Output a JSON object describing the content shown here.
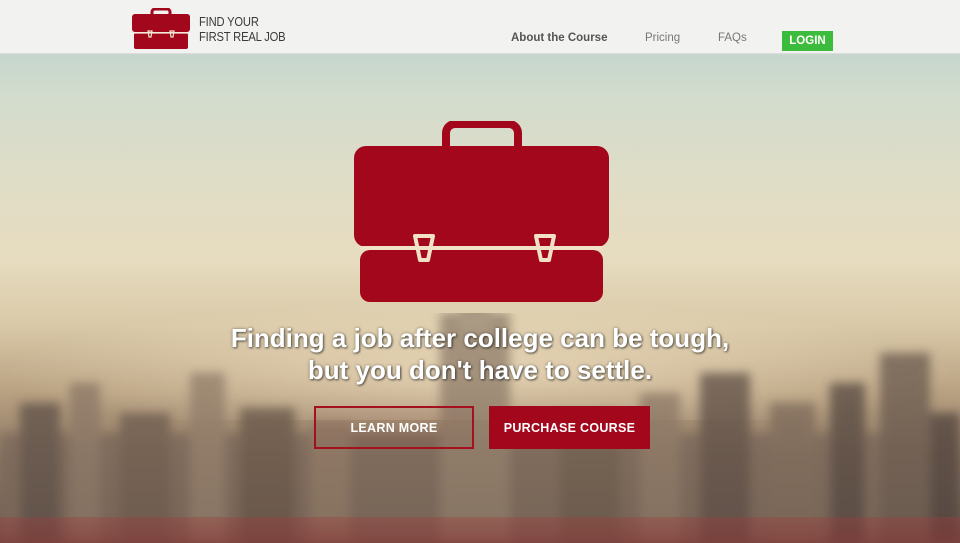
{
  "header": {
    "logo_line1": "FIND YOUR",
    "logo_line2": "FIRST REAL JOB",
    "nav": [
      {
        "label": "About the Course",
        "active": true
      },
      {
        "label": "Pricing",
        "active": false
      },
      {
        "label": "FAQs",
        "active": false
      }
    ],
    "login_label": "LOGIN"
  },
  "hero": {
    "headline_line1": "Finding a job after college can be tough,",
    "headline_line2": "but you don't have to settle.",
    "learn_more_label": "LEARN MORE",
    "purchase_label": "PURCHASE COURSE",
    "icon": "briefcase-icon"
  },
  "colors": {
    "brand_red": "#a3071c",
    "login_green": "#3dbb3d",
    "header_bg": "#f2f2f0"
  }
}
